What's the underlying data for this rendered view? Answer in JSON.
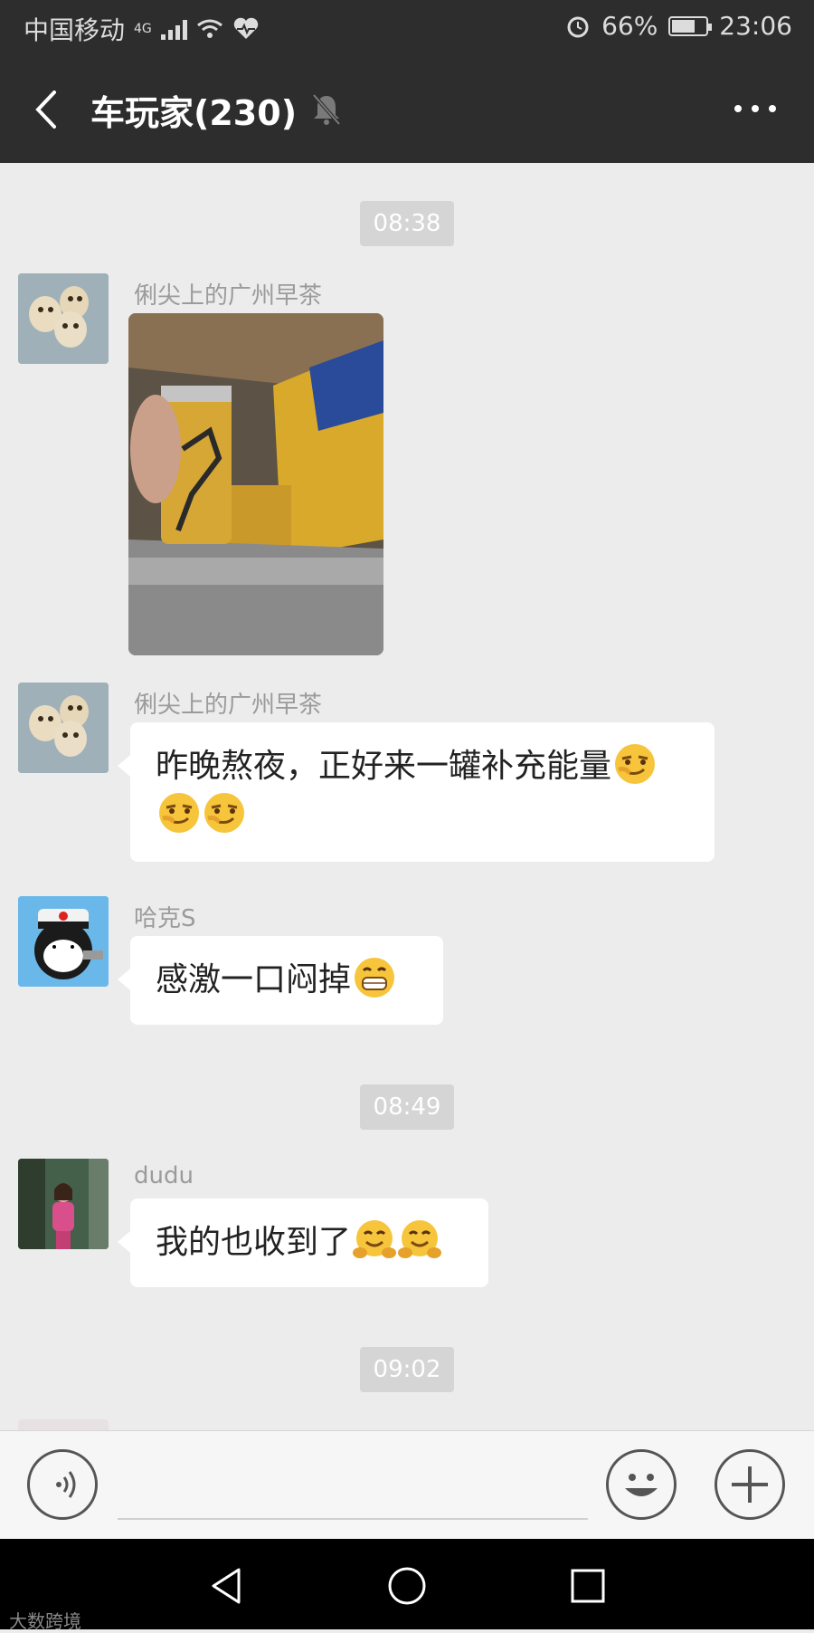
{
  "status_bar": {
    "carrier": "中国移动",
    "network": "4G",
    "battery": "66%",
    "battery_level": 0.66,
    "time": "23:06"
  },
  "header": {
    "title": "车玩家(230)",
    "back_icon": "chevron-left-icon",
    "mute_icon": "bell-muted-icon",
    "more_icon": "more-dots-icon"
  },
  "timestamps": [
    "08:38",
    "08:49",
    "09:02"
  ],
  "messages": [
    {
      "sender": "俐尖上的广州早茶",
      "type": "image",
      "image_desc": "photo"
    },
    {
      "sender": "俐尖上的广州早茶",
      "type": "text",
      "line1": "昨晚熬夜，正好来一罐补充能量",
      "emoji": "smirk-emoji"
    },
    {
      "sender": "哈克S",
      "type": "text",
      "text": "感激一口闷掉",
      "emoji": "grin-emoji"
    },
    {
      "sender": "dudu",
      "type": "text",
      "text": "我的也收到了",
      "emoji": "hug-emoji"
    }
  ],
  "input": {
    "voice_icon": "voice-icon",
    "emoji_icon": "smiley-icon",
    "plus_icon": "plus-icon"
  },
  "navbar": {
    "back_icon": "triangle-back-icon",
    "home_icon": "circle-home-icon",
    "recents_icon": "square-recents-icon"
  },
  "watermark": "大数跨境"
}
